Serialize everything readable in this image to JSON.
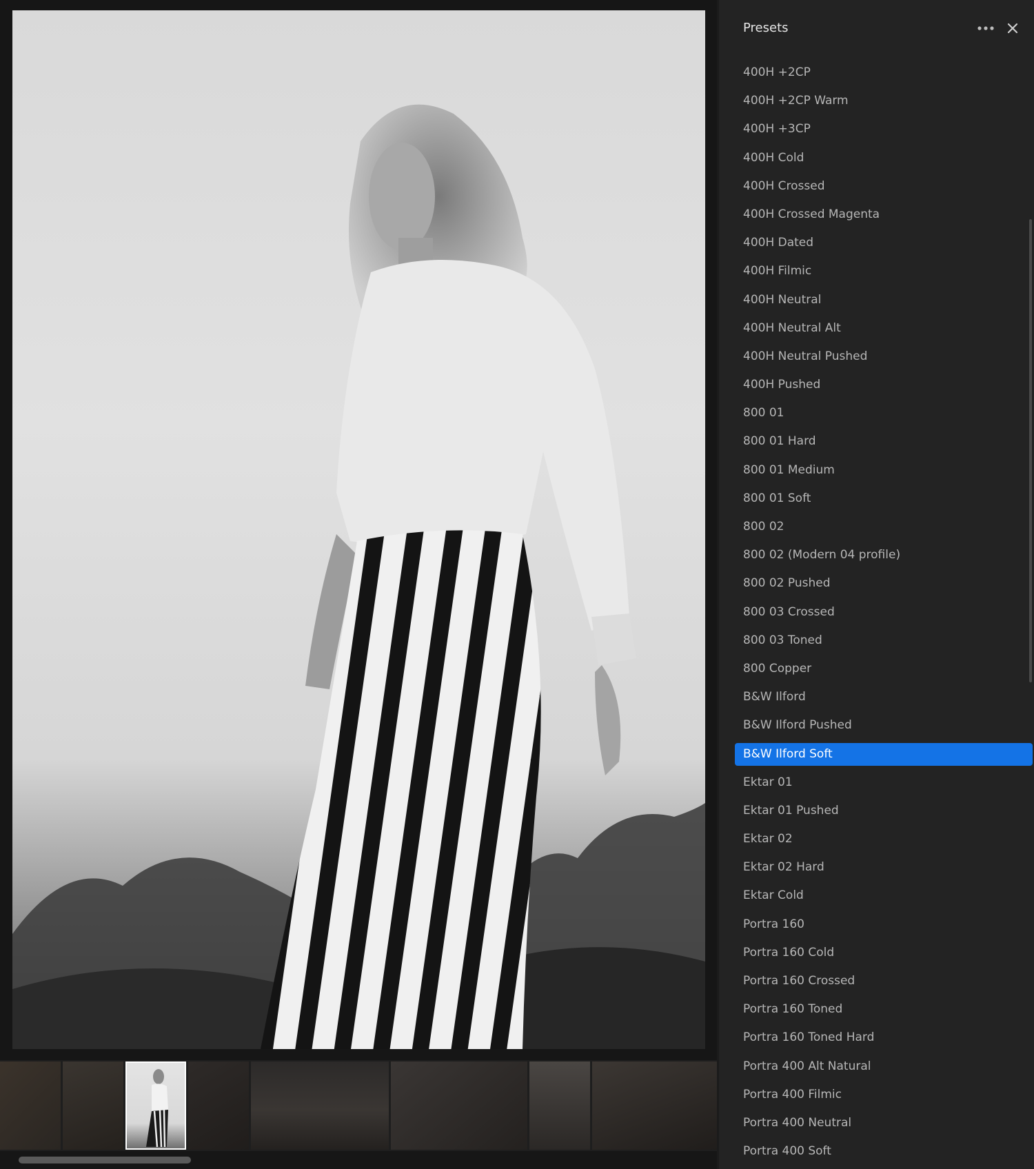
{
  "panel": {
    "title": "Presets",
    "more_icon": "more-horizontal-icon",
    "close_icon": "close-icon",
    "accent_color": "#1473e6",
    "selected_index": 24,
    "presets": [
      "400H +2CP",
      "400H +2CP Warm",
      "400H +3CP",
      "400H Cold",
      "400H Crossed",
      "400H Crossed Magenta",
      "400H Dated",
      "400H Filmic",
      "400H Neutral",
      "400H Neutral Alt",
      "400H Neutral Pushed",
      "400H Pushed",
      "800 01",
      "800 01 Hard",
      "800 01 Medium",
      "800 01 Soft",
      "800 02",
      "800 02 (Modern 04 profile)",
      "800 02 Pushed",
      "800 03 Crossed",
      "800 03 Toned",
      "800 Copper",
      "B&W Ilford",
      "B&W Ilford Pushed",
      "B&W Ilford Soft",
      "Ektar 01",
      "Ektar 01 Pushed",
      "Ektar 02",
      "Ektar 02 Hard",
      "Ektar Cold",
      "Portra 160",
      "Portra 160 Cold",
      "Portra 160 Crossed",
      "Portra 160 Toned",
      "Portra 160 Toned Hard",
      "Portra 400 Alt Natural",
      "Portra 400 Filmic",
      "Portra 400 Neutral",
      "Portra 400 Soft"
    ]
  },
  "filmstrip": {
    "thumbnail_count": 10,
    "selected_index": 2
  }
}
